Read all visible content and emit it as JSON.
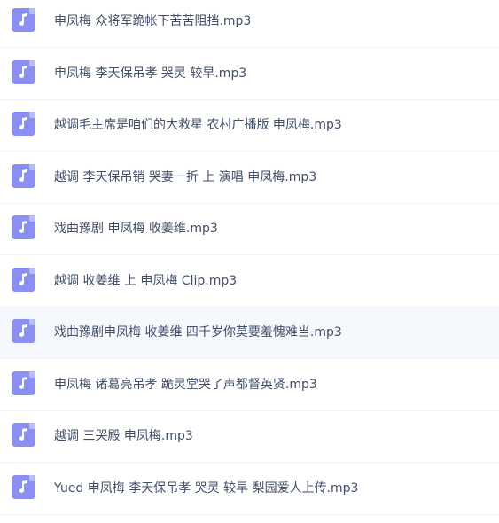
{
  "files": [
    {
      "name": "申凤梅 众将军跪帐下苦苦阻挡.mp3",
      "icon": "music-note-icon"
    },
    {
      "name": "申凤梅 李天保吊孝 哭灵 较早.mp3",
      "icon": "music-note-icon"
    },
    {
      "name": "越调毛主席是咱们的大救星 农村广播版 申凤梅.mp3",
      "icon": "music-note-icon"
    },
    {
      "name": "越调 李天保吊销 哭妻一折 上 演唱 申凤梅.mp3",
      "icon": "music-note-icon"
    },
    {
      "name": "戏曲豫剧 申凤梅 收姜维.mp3",
      "icon": "music-note-icon"
    },
    {
      "name": "越调 收姜维 上 申凤梅 Clip.mp3",
      "icon": "music-note-icon"
    },
    {
      "name": "戏曲豫剧申凤梅 收姜维 四千岁你莫要羞愧难当.mp3",
      "icon": "music-note-icon"
    },
    {
      "name": "申凤梅 诸葛亮吊孝 跪灵堂哭了声都督英贤.mp3",
      "icon": "music-note-icon"
    },
    {
      "name": "越调 三哭殿 申凤梅.mp3",
      "icon": "music-note-icon"
    },
    {
      "name": "Yued 申凤梅 李天保吊孝 哭灵 较早 梨园爱人上传.mp3",
      "icon": "music-note-icon"
    }
  ],
  "colors": {
    "icon_bg": "#8b8ff2",
    "text": "#424e67",
    "hover_row": "#f5f8fc",
    "divider": "#eef0f4"
  }
}
